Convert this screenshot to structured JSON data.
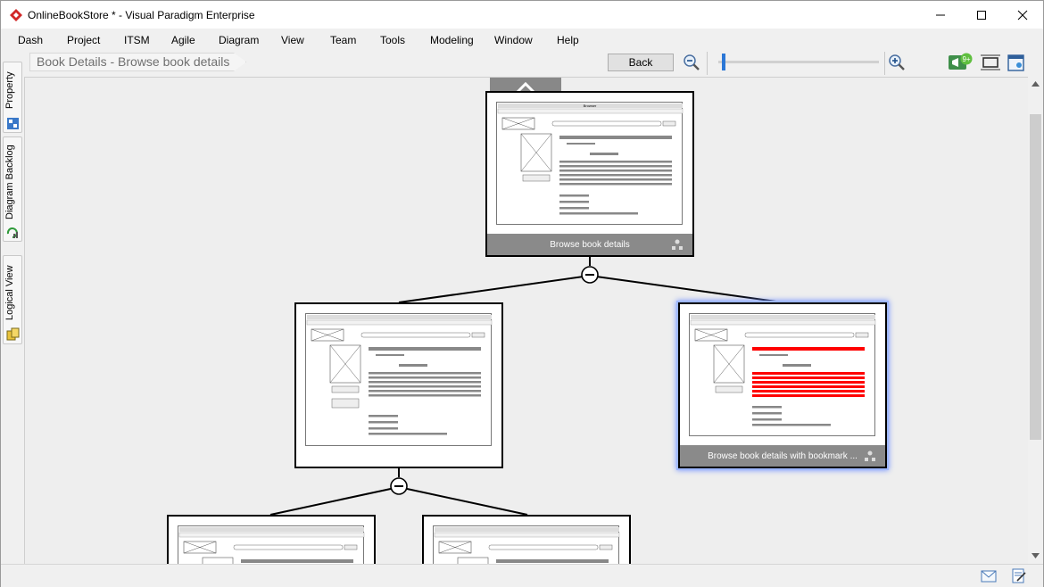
{
  "window": {
    "title": "OnlineBookStore * - Visual Paradigm Enterprise",
    "controls": [
      "minimize",
      "maximize",
      "close"
    ]
  },
  "menu": {
    "items": [
      "Dash",
      "Project",
      "ITSM",
      "Agile",
      "Diagram",
      "View",
      "Team",
      "Tools",
      "Modeling",
      "Window",
      "Help"
    ]
  },
  "left_rail": {
    "tabs": [
      "Property",
      "Diagram Backlog",
      "Logical View"
    ]
  },
  "toolbar": {
    "breadcrumb": "Book Details - Browse book details",
    "back_label": "Back",
    "notification_badge": "9+"
  },
  "diagram": {
    "root_caption": "Browse book details",
    "child_left_caption": "",
    "child_right_caption": "Browse book details with bookmark ...",
    "wireframe_window_title": "Browser",
    "wireframe_nav": "|← →| C",
    "wireframe_search_label": "Search:",
    "wireframe_price_label": "Price:",
    "wireframe_cart_button": "Add to Cart",
    "wireframe_product_button": "Product",
    "wireframe_fields": [
      "Author:",
      "ISBN:",
      "Publish Date:",
      "Category:"
    ]
  },
  "colors": {
    "highlight_red": "#ff0000",
    "selection_glow": "#6f8fff",
    "caption_bar": "#8a8a8a",
    "zoom_thumb": "#2b77d6"
  }
}
